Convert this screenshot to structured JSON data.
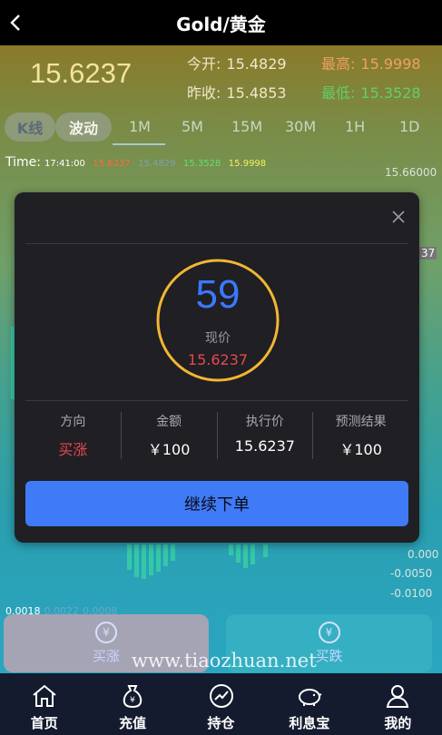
{
  "header": {
    "title": "Gold/黄金"
  },
  "quote": {
    "current": "15.6237",
    "open_label": "今开:",
    "open": "15.4829",
    "prev_label": "昨收:",
    "prev": "15.4853",
    "high_label": "最高:",
    "high": "15.9998",
    "low_label": "最低:",
    "low": "15.3528"
  },
  "tabs": {
    "kline": "K线",
    "wave": "波动",
    "periods": [
      "1M",
      "5M",
      "15M",
      "30M",
      "1H",
      "1D"
    ]
  },
  "time_row": {
    "label": "Time:",
    "time": "17:41:00",
    "v1": "15.6237",
    "v2": "15.4829",
    "v3": "15.3528",
    "v4": "15.9998"
  },
  "axis": {
    "top": "15.66000",
    "price_tag": "37",
    "neg1": "-0.0050",
    "neg2": "-0.0100",
    "zero": "0.000"
  },
  "small_vals": {
    "a": "0.0018",
    "b": "0.0022",
    "c": "0.0008"
  },
  "modal": {
    "countdown": "59",
    "now_label": "现价",
    "now_price": "15.6237",
    "columns": [
      {
        "header": "方向",
        "value": "买涨"
      },
      {
        "header": "金额",
        "value": "￥100"
      },
      {
        "header": "执行价",
        "value": "15.6237"
      },
      {
        "header": "预测结果",
        "value": "￥100"
      }
    ],
    "continue_label": "继续下单"
  },
  "buttons": {
    "buy_up": "买涨",
    "buy_down": "买跌"
  },
  "watermark": "www.tiaozhuan.net",
  "nav": {
    "items": [
      {
        "label": "首页",
        "icon": "home-icon"
      },
      {
        "label": "充值",
        "icon": "money-bag-icon"
      },
      {
        "label": "持仓",
        "icon": "chart-circle-icon"
      },
      {
        "label": "利息宝",
        "icon": "piggy-bank-icon"
      },
      {
        "label": "我的",
        "icon": "user-icon"
      }
    ]
  },
  "colors": {
    "accent_blue": "#3f7bf6",
    "up_red": "#e8484e",
    "ring_yellow": "#f2b632",
    "low_green": "#5fd06a",
    "high_orange": "#f0a060"
  }
}
